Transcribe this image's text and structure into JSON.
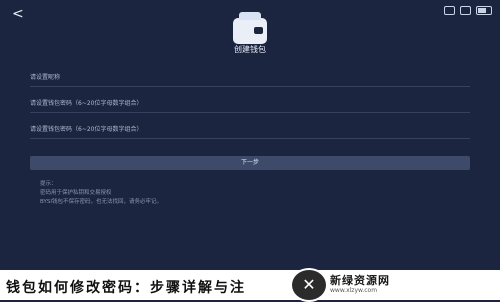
{
  "status_bar": {
    "back": "<"
  },
  "header": {
    "title": "创建钱包"
  },
  "fields": [
    {
      "placeholder": "请设置昵称"
    },
    {
      "placeholder": "请设置钱包密码（6~20位字母数字组合）"
    },
    {
      "placeholder": "请设置钱包密码（6~20位字母数字组合）"
    }
  ],
  "next_button": {
    "label": "下一步"
  },
  "tips": [
    "提示：",
    "密码用于保护私钥和交易授权",
    "BYSI钱包不保存密码，也无法找回，请务必牢记。"
  ],
  "caption": {
    "text": "钱包如何修改密码：步骤详解与注"
  },
  "watermark": {
    "name": "新绿资源网",
    "url": "www.xlzyw.com",
    "logo": "✕"
  }
}
